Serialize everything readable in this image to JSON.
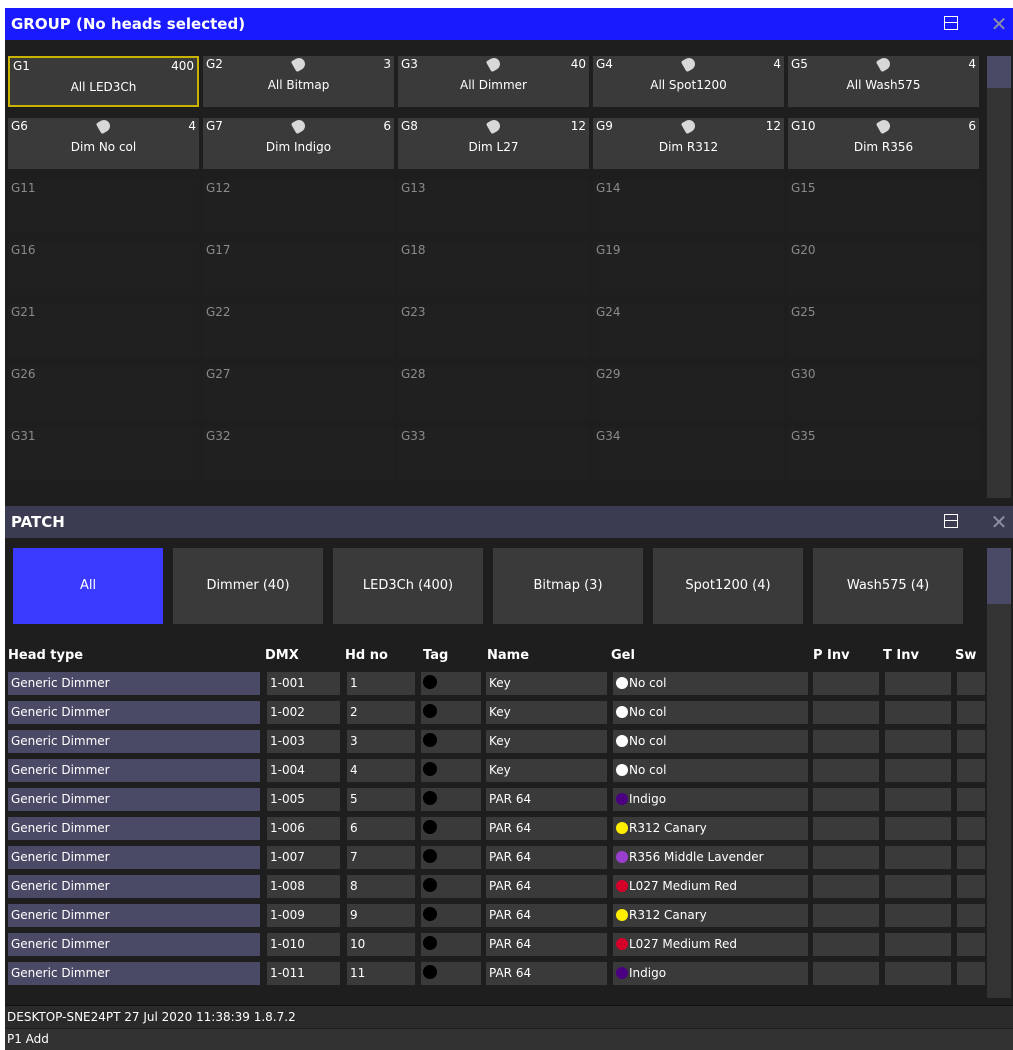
{
  "group_window": {
    "title": "GROUP (No heads selected)",
    "filled": [
      {
        "id": "G1",
        "name": "All LED3Ch",
        "count": "400",
        "icon": false
      },
      {
        "id": "G2",
        "name": "All Bitmap",
        "count": "3",
        "icon": true
      },
      {
        "id": "G3",
        "name": "All Dimmer",
        "count": "40",
        "icon": true
      },
      {
        "id": "G4",
        "name": "All Spot1200",
        "count": "4",
        "icon": true
      },
      {
        "id": "G5",
        "name": "All Wash575",
        "count": "4",
        "icon": true
      },
      {
        "id": "G6",
        "name": "Dim No col",
        "count": "4",
        "icon": true
      },
      {
        "id": "G7",
        "name": "Dim Indigo",
        "count": "6",
        "icon": true
      },
      {
        "id": "G8",
        "name": "Dim L27",
        "count": "12",
        "icon": true
      },
      {
        "id": "G9",
        "name": "Dim R312",
        "count": "12",
        "icon": true
      },
      {
        "id": "G10",
        "name": "Dim R356",
        "count": "6",
        "icon": true
      }
    ],
    "empty": [
      "G11",
      "G12",
      "G13",
      "G14",
      "G15",
      "G16",
      "G17",
      "G18",
      "G19",
      "G20",
      "G21",
      "G22",
      "G23",
      "G24",
      "G25",
      "G26",
      "G27",
      "G28",
      "G29",
      "G30",
      "G31",
      "G32",
      "G33",
      "G34",
      "G35"
    ]
  },
  "patch_window": {
    "title": "PATCH",
    "tabs": [
      "All",
      "Dimmer (40)",
      "LED3Ch (400)",
      "Bitmap (3)",
      "Spot1200 (4)",
      "Wash575 (4)"
    ],
    "headers": {
      "head_type": "Head type",
      "dmx": "DMX",
      "hd_no": "Hd no",
      "tag": "Tag",
      "name": "Name",
      "gel": "Gel",
      "p_inv": "P Inv",
      "t_inv": "T Inv",
      "swap": "Sw"
    },
    "rows": [
      {
        "head_type": "Generic Dimmer",
        "dmx": "1-001",
        "hd_no": "1",
        "name": "Key",
        "gel": "No col",
        "gel_color": "#ffffff"
      },
      {
        "head_type": "Generic Dimmer",
        "dmx": "1-002",
        "hd_no": "2",
        "name": "Key",
        "gel": "No col",
        "gel_color": "#ffffff"
      },
      {
        "head_type": "Generic Dimmer",
        "dmx": "1-003",
        "hd_no": "3",
        "name": "Key",
        "gel": "No col",
        "gel_color": "#ffffff"
      },
      {
        "head_type": "Generic Dimmer",
        "dmx": "1-004",
        "hd_no": "4",
        "name": "Key",
        "gel": "No col",
        "gel_color": "#ffffff"
      },
      {
        "head_type": "Generic Dimmer",
        "dmx": "1-005",
        "hd_no": "5",
        "name": "PAR 64",
        "gel": "Indigo",
        "gel_color": "#4b0082"
      },
      {
        "head_type": "Generic Dimmer",
        "dmx": "1-006",
        "hd_no": "6",
        "name": "PAR 64",
        "gel": "R312 Canary",
        "gel_color": "#ffee00"
      },
      {
        "head_type": "Generic Dimmer",
        "dmx": "1-007",
        "hd_no": "7",
        "name": "PAR 64",
        "gel": "R356 Middle Lavender",
        "gel_color": "#9a3fd0"
      },
      {
        "head_type": "Generic Dimmer",
        "dmx": "1-008",
        "hd_no": "8",
        "name": "PAR 64",
        "gel": "L027 Medium Red",
        "gel_color": "#d4002a"
      },
      {
        "head_type": "Generic Dimmer",
        "dmx": "1-009",
        "hd_no": "9",
        "name": "PAR 64",
        "gel": "R312 Canary",
        "gel_color": "#ffee00"
      },
      {
        "head_type": "Generic Dimmer",
        "dmx": "1-010",
        "hd_no": "10",
        "name": "PAR 64",
        "gel": "L027 Medium Red",
        "gel_color": "#d4002a"
      },
      {
        "head_type": "Generic Dimmer",
        "dmx": "1-011",
        "hd_no": "11",
        "name": "PAR 64",
        "gel": "Indigo",
        "gel_color": "#4b0082"
      }
    ]
  },
  "status": {
    "info": "DESKTOP-SNE24PT 27 Jul 2020 11:38:39 1.8.7.2",
    "command": "P1 Add"
  },
  "colors": {
    "group_titlebar": "#1a1aff",
    "patch_titlebar": "#3b3b52",
    "active_tab": "#3b3bff",
    "selected_border": "#c8b400"
  }
}
